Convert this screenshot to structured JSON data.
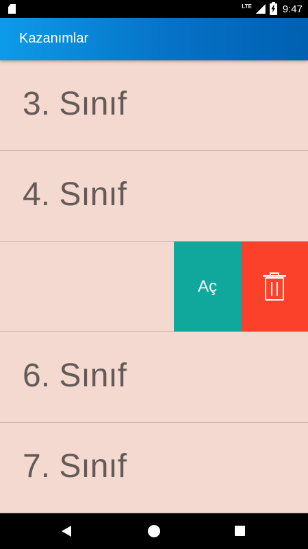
{
  "status_bar": {
    "network": "LTE",
    "time": "9:47",
    "icons": [
      "sd-card-icon",
      "signal-icon",
      "battery-charging-icon"
    ]
  },
  "app_bar": {
    "title": "Kazanımlar"
  },
  "list": {
    "items": [
      {
        "label": "3. Sınıf"
      },
      {
        "label": "4. Sınıf"
      },
      {
        "label": "",
        "swiped": true
      },
      {
        "label": "6. Sınıf"
      },
      {
        "label": "7. Sınıf"
      }
    ]
  },
  "swipe_actions": {
    "open_label": "Aç",
    "open_color": "#10a89d",
    "delete_icon": "trash-icon",
    "delete_color": "#fb4129"
  },
  "background_color": "#f3d9cf",
  "nav_bar": {
    "icons": [
      "back-icon",
      "home-icon",
      "recents-icon"
    ]
  }
}
